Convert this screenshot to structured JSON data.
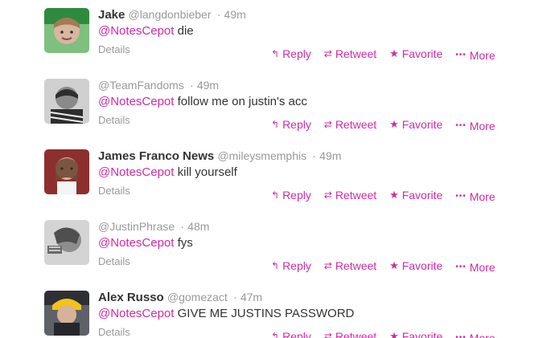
{
  "tweets": [
    {
      "full_name": "Jake",
      "screen_name": "@langdonbieber",
      "separator": "·",
      "time": "49m",
      "mention": "@NotesCepot",
      "text": " die",
      "details_label": "Details",
      "actions": {
        "reply": "Reply",
        "retweet": "Retweet",
        "favorite": "Favorite",
        "more": "More"
      }
    },
    {
      "full_name": "",
      "screen_name": "@TeamFandoms",
      "separator": "·",
      "time": "49m",
      "mention": "@NotesCepot",
      "text": " follow me on justin's acc",
      "details_label": "Details",
      "actions": {
        "reply": "Reply",
        "retweet": "Retweet",
        "favorite": "Favorite",
        "more": "More"
      }
    },
    {
      "full_name": "James Franco News",
      "screen_name": "@mileysmemphis",
      "separator": "·",
      "time": "49m",
      "mention": "@NotesCepot",
      "text": " kill yourself",
      "details_label": "Details",
      "actions": {
        "reply": "Reply",
        "retweet": "Retweet",
        "favorite": "Favorite",
        "more": "More"
      }
    },
    {
      "full_name": "",
      "screen_name": "@JustinPhrase",
      "separator": "·",
      "time": "48m",
      "mention": "@NotesCepot",
      "text": " fys",
      "details_label": "Details",
      "actions": {
        "reply": "Reply",
        "retweet": "Retweet",
        "favorite": "Favorite",
        "more": "More"
      }
    },
    {
      "full_name": "Alex Russo",
      "screen_name": "@gomezact",
      "separator": "·",
      "time": "47m",
      "mention": "@NotesCepot",
      "text": " GIVE ME JUSTINS PASSWORD",
      "details_label": "Details",
      "actions": {
        "reply": "Reply",
        "retweet": "Retweet",
        "favorite": "Favorite",
        "more": "More"
      }
    }
  ],
  "icons": {
    "reply": "reply-icon",
    "retweet": "retweet-icon",
    "favorite": "star-icon",
    "more": "more-icon"
  },
  "colors": {
    "link": "#d12aa6",
    "text": "#333333",
    "meta": "#999999",
    "divider": "#e6e6e6"
  }
}
